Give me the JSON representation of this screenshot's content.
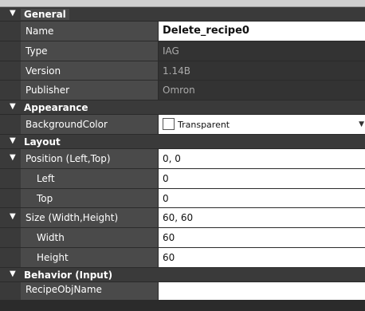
{
  "categories": {
    "general": "General",
    "appearance": "Appearance",
    "layout": "Layout",
    "behavior": "Behavior (Input)"
  },
  "general": {
    "name_label": "Name",
    "name_value": "Delete_recipe0",
    "type_label": "Type",
    "type_value": "IAG",
    "version_label": "Version",
    "version_value": "1.14B",
    "publisher_label": "Publisher",
    "publisher_value": "Omron"
  },
  "appearance": {
    "bg_label": "BackgroundColor",
    "bg_value": "Transparent"
  },
  "layout": {
    "position_label": "Position (Left,Top)",
    "position_value": "0, 0",
    "left_label": "Left",
    "left_value": "0",
    "top_label": "Top",
    "top_value": "0",
    "size_label": "Size (Width,Height)",
    "size_value": "60, 60",
    "width_label": "Width",
    "width_value": "60",
    "height_label": "Height",
    "height_value": "60"
  },
  "behavior": {
    "recipe_label": "RecipeObjName",
    "recipe_value": ""
  },
  "icons": {
    "expand": "triangle-down-icon",
    "dropdown": "chevron-down-icon"
  },
  "colors": {
    "panel": "#3a3a3a",
    "name_cell": "#4a4a4a",
    "value_cell": "#ffffff",
    "readonly": "#333333"
  }
}
